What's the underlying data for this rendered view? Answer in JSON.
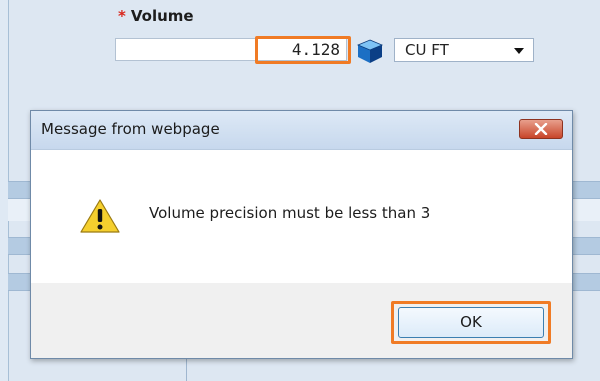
{
  "form": {
    "required_marker": "*",
    "volume_label": "Volume",
    "volume_value": "4.128",
    "unit_selected": "CU FT",
    "icons": {
      "unit_icon": "cube-icon",
      "unit_dropdown": "chevron-down-icon"
    }
  },
  "dialog": {
    "title": "Message from webpage",
    "message": "Volume precision must be less than 3",
    "ok_label": "OK",
    "icons": {
      "alert": "warning-icon",
      "close": "close-icon"
    }
  },
  "colors": {
    "highlight": "#f07b25",
    "required": "#d9261c",
    "close_button": "#c8452a"
  }
}
